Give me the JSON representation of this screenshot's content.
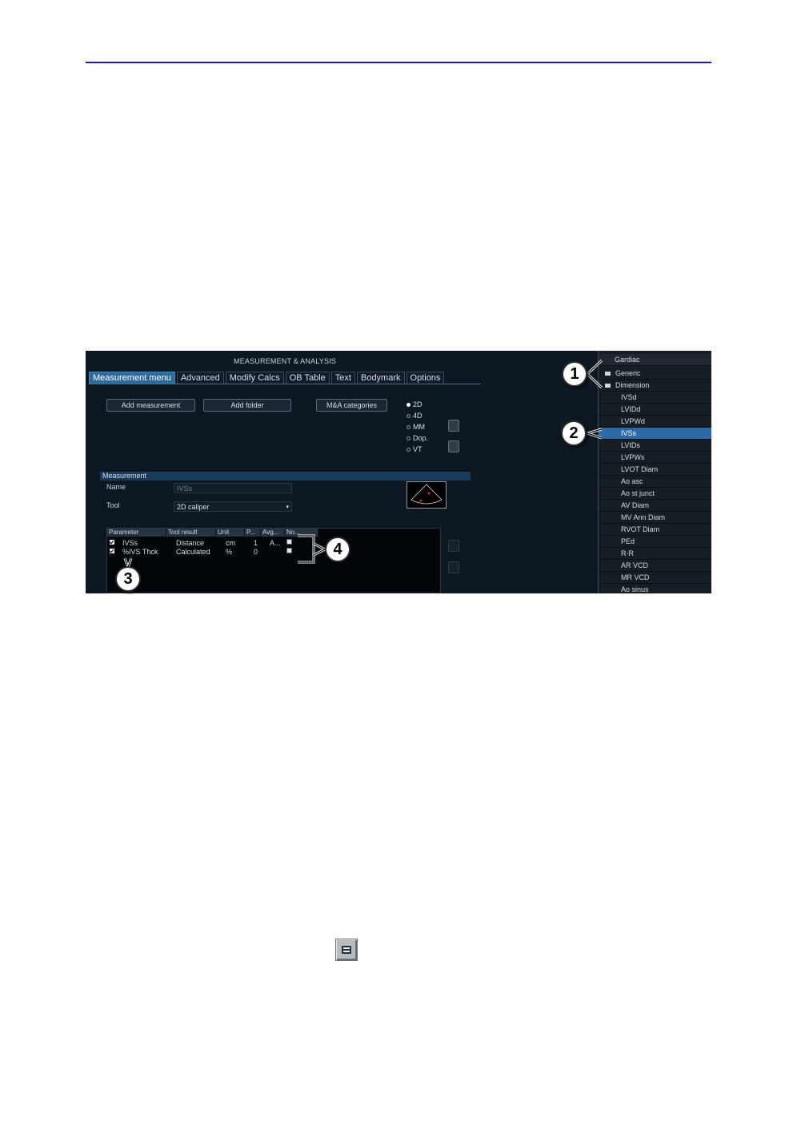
{
  "screen": {
    "title": "MEASUREMENT & ANALYSIS",
    "tabs": [
      "Measurement menu",
      "Advanced",
      "Modify Calcs",
      "OB Table",
      "Text",
      "Bodymark",
      "Options"
    ],
    "buttons": {
      "add_measurement": "Add measurement",
      "add_folder": "Add folder",
      "categories": "M&A categories"
    },
    "modes": [
      {
        "label": "2D",
        "selected": true
      },
      {
        "label": "4D",
        "selected": false
      },
      {
        "label": "MM",
        "selected": false
      },
      {
        "label": "Dop.",
        "selected": false
      },
      {
        "label": "VT",
        "selected": false
      }
    ],
    "measurement": {
      "header": "Measurement",
      "name_label": "Name",
      "name_value": "IVSs",
      "tool_label": "Tool",
      "tool_value": "2D caliper"
    },
    "table": {
      "columns": [
        "Parameter",
        "Tool result",
        "Unit",
        "P...",
        "Avg...",
        "No..."
      ],
      "rows": [
        {
          "checked": true,
          "parameter": "IVSs",
          "tool_result": "Distance",
          "unit": "cm",
          "p": "1",
          "avg": "A..."
        },
        {
          "checked": true,
          "parameter": "%IVS Thck",
          "tool_result": "Calculated",
          "unit": "%",
          "p": "0",
          "avg": ""
        }
      ]
    },
    "tree": {
      "items": [
        {
          "label": "Gardiac",
          "kind": "header"
        },
        {
          "label": "Generic",
          "kind": "folder"
        },
        {
          "label": "Dimension",
          "kind": "folder"
        },
        {
          "label": "IVSd",
          "kind": "item"
        },
        {
          "label": "LVIDd",
          "kind": "item"
        },
        {
          "label": "LVPWd",
          "kind": "item"
        },
        {
          "label": "IVSs",
          "kind": "item",
          "selected": true
        },
        {
          "label": "LVIDs",
          "kind": "item"
        },
        {
          "label": "LVPWs",
          "kind": "item"
        },
        {
          "label": "LVOT Diam",
          "kind": "item"
        },
        {
          "label": "Ao asc",
          "kind": "item"
        },
        {
          "label": "Ao st junct",
          "kind": "item"
        },
        {
          "label": "AV Diam",
          "kind": "item"
        },
        {
          "label": "MV Ann Diam",
          "kind": "item"
        },
        {
          "label": "RVOT Diam",
          "kind": "item"
        },
        {
          "label": "PEd",
          "kind": "item"
        },
        {
          "label": "R-R",
          "kind": "item"
        },
        {
          "label": "AR VCD",
          "kind": "item"
        },
        {
          "label": "MR VCD",
          "kind": "item"
        },
        {
          "label": "Ao sinus",
          "kind": "item"
        }
      ]
    }
  },
  "callouts": [
    "1",
    "2",
    "3",
    "4"
  ],
  "icons": {
    "equal_button": "equals-icon"
  },
  "colors": {
    "rule": "#1f1fa6",
    "selection": "#2f6aa8",
    "active_tab": "#2f6a9c",
    "panel_bg": "#0c1722"
  }
}
